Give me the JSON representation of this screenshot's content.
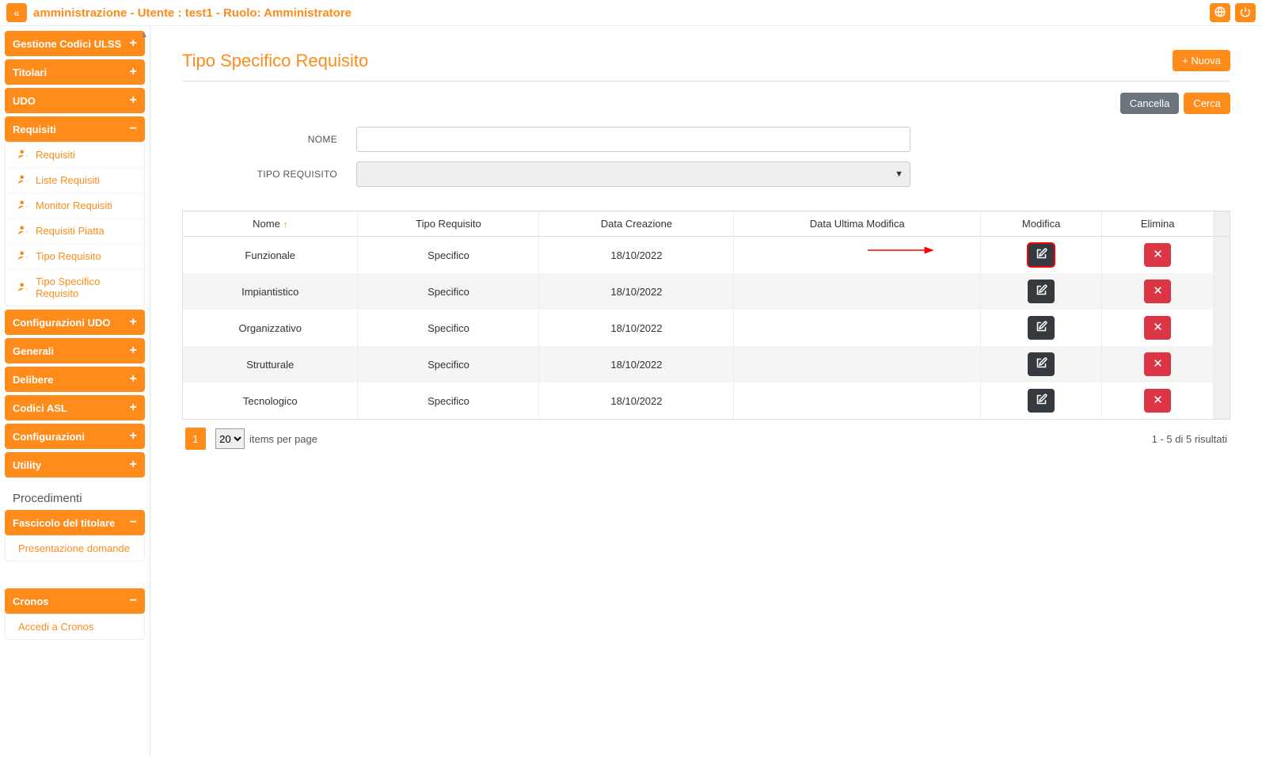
{
  "header": {
    "title": "amministrazione - Utente : test1 - Ruolo: Amministratore"
  },
  "sidebar": {
    "groups": [
      {
        "label": "Gestione Codici ULSS",
        "icon": "+"
      },
      {
        "label": "Titolari",
        "icon": "+"
      },
      {
        "label": "UDO",
        "icon": "+"
      },
      {
        "label": "Requisiti",
        "icon": "−",
        "open": true
      }
    ],
    "requisiti_items": [
      "Requisiti",
      "Liste Requisiti",
      "Monitor Requisiti",
      "Requisiti Piatta",
      "Tipo Requisito",
      "Tipo Specifico Requisito"
    ],
    "groups2": [
      {
        "label": "Configurazioni UDO",
        "icon": "+"
      },
      {
        "label": "Generali",
        "icon": "+"
      },
      {
        "label": "Delibere",
        "icon": "+"
      },
      {
        "label": "Codici ASL",
        "icon": "+"
      },
      {
        "label": "Configurazioni",
        "icon": "+"
      },
      {
        "label": "Utility",
        "icon": "+"
      }
    ],
    "procedimenti_heading": "Procedimenti",
    "fascicolo": {
      "label": "Fascicolo del titolare",
      "icon": "−"
    },
    "fascicolo_items": [
      "Presentazione domande"
    ],
    "cronos": {
      "label": "Cronos",
      "icon": "−"
    },
    "cronos_items": [
      "Accedi a Cronos"
    ]
  },
  "page": {
    "title": "Tipo Specifico Requisito",
    "new_button": "Nuova",
    "cancel_button": "Cancella",
    "search_button": "Cerca",
    "form": {
      "nome_label": "NOME",
      "tipo_label": "TIPO REQUISITO"
    },
    "table": {
      "columns": [
        "Nome",
        "Tipo Requisito",
        "Data Creazione",
        "Data Ultima Modifica",
        "Modifica",
        "Elimina"
      ],
      "rows": [
        {
          "nome": "Funzionale",
          "tipo": "Specifico",
          "creazione": "18/10/2022",
          "modifica": "",
          "highlight": true
        },
        {
          "nome": "Impiantistico",
          "tipo": "Specifico",
          "creazione": "18/10/2022",
          "modifica": ""
        },
        {
          "nome": "Organizzativo",
          "tipo": "Specifico",
          "creazione": "18/10/2022",
          "modifica": ""
        },
        {
          "nome": "Strutturale",
          "tipo": "Specifico",
          "creazione": "18/10/2022",
          "modifica": ""
        },
        {
          "nome": "Tecnologico",
          "tipo": "Specifico",
          "creazione": "18/10/2022",
          "modifica": ""
        }
      ]
    },
    "pager": {
      "current_page": "1",
      "page_size": "20",
      "per_page_label": "items per page",
      "results": "1 - 5 di 5 risultati"
    }
  }
}
